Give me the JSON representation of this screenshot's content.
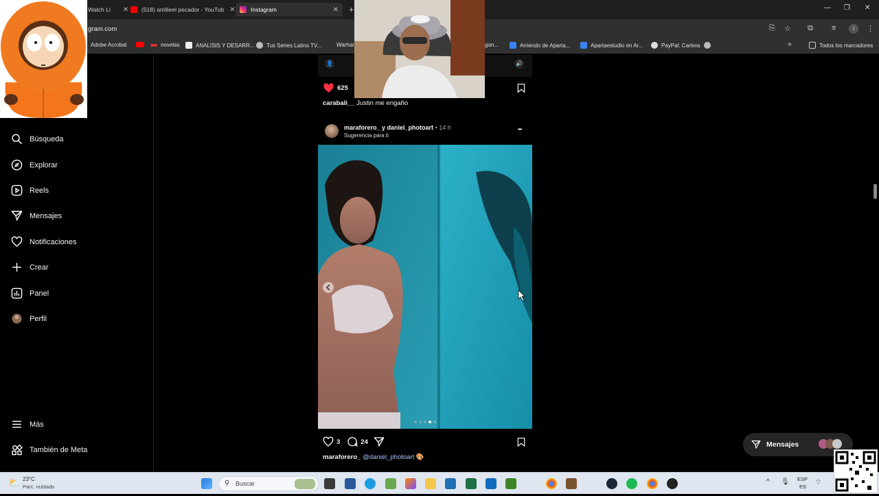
{
  "browser": {
    "tabs": [
      {
        "title": "Watch Li",
        "close": "✕"
      },
      {
        "title": "(518) amllieel pecador - YouTub",
        "close": "✕"
      },
      {
        "title": "Instagram",
        "close": "✕"
      }
    ],
    "new_tab": "+",
    "url": "gram.com",
    "bookmarks": [
      "Adobe Acrobat",
      "novelas",
      "ANALISIS Y DESARR...",
      "Tus Series Latino TV...",
      "Warhar",
      "gon...",
      "Arriendo de Aparta...",
      "Apartaestudio en Ar...",
      "PayPal: Cartera",
      "Todos los marcadores"
    ],
    "more_bookmarks": "»"
  },
  "sidebar": {
    "items": [
      {
        "label": "Búsqueda",
        "icon": "search-icon"
      },
      {
        "label": "Explorar",
        "icon": "compass-icon"
      },
      {
        "label": "Reels",
        "icon": "reels-icon"
      },
      {
        "label": "Mensajes",
        "icon": "send-icon"
      },
      {
        "label": "Notificaciones",
        "icon": "heart-icon"
      },
      {
        "label": "Crear",
        "icon": "plus-icon"
      },
      {
        "label": "Panel",
        "icon": "chart-icon"
      },
      {
        "label": "Perfil",
        "icon": "avatar-icon"
      }
    ],
    "more": "Más",
    "meta": "También de Meta"
  },
  "previous_post": {
    "likes": "625",
    "caption_user": "carabali__",
    "caption_text": "Justin me engaño"
  },
  "post": {
    "author": "maraforero_ y daniel_photoart",
    "time": "• 14 h",
    "subtitle": "Sugerencia para ti",
    "more": "•••",
    "likes": "3",
    "comments": "24",
    "caption_user": "maraforero_",
    "caption_mention": "@daniel_photoart",
    "caption_emoji": "🎨",
    "carousel_dots": 5,
    "carousel_active": 3
  },
  "messages_button": {
    "label": "Mensajes"
  },
  "taskbar": {
    "weather_temp": "23°C",
    "weather_desc": "Parc. nublado",
    "search_placeholder": "Buscar",
    "lang_top": "ESP",
    "lang_bottom": "ES"
  },
  "colors": {
    "ig_bg": "#000000",
    "heart_red": "#ff3040",
    "mention_blue": "#e0f1ff",
    "teal_photo": "#1b8ea8"
  }
}
